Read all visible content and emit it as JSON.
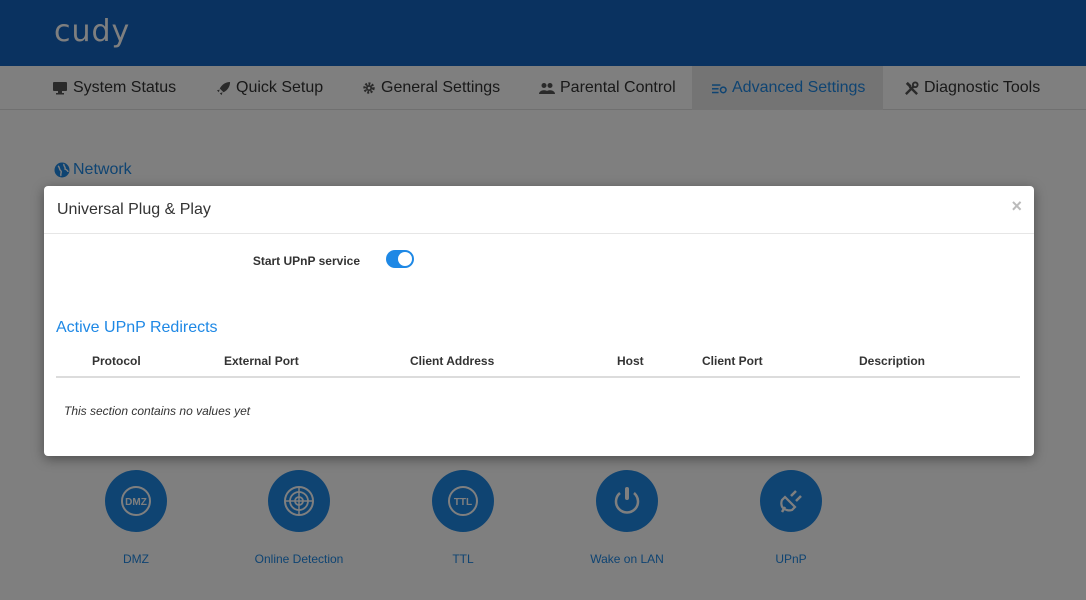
{
  "brand": {
    "logo": "cudy"
  },
  "nav": [
    {
      "label": "System Status",
      "icon": "monitor-icon"
    },
    {
      "label": "Quick Setup",
      "icon": "rocket-icon"
    },
    {
      "label": "General Settings",
      "icon": "gear-icon"
    },
    {
      "label": "Parental Control",
      "icon": "users-icon"
    },
    {
      "label": "Advanced Settings",
      "icon": "sliders-icon",
      "active": true
    },
    {
      "label": "Diagnostic Tools",
      "icon": "tools-icon"
    }
  ],
  "section": {
    "title": "Network",
    "icon": "globe-icon"
  },
  "tiles": [
    {
      "label": "DMZ",
      "icon": "dmz-icon",
      "text": "DMZ"
    },
    {
      "label": "Online Detection",
      "icon": "target-icon"
    },
    {
      "label": "TTL",
      "icon": "ttl-icon",
      "text": "TTL"
    },
    {
      "label": "Wake on LAN",
      "icon": "power-icon"
    },
    {
      "label": "UPnP",
      "icon": "plug-icon"
    }
  ],
  "modal": {
    "title": "Universal Plug & Play",
    "close": "×",
    "field_label": "Start UPnP service",
    "toggle_on": true,
    "subtitle": "Active UPnP Redirects",
    "columns": [
      "Protocol",
      "External Port",
      "Client Address",
      "Host",
      "Client Port",
      "Description"
    ],
    "empty_message": "This section contains no values yet"
  },
  "colors": {
    "brand": "#1565c0",
    "accent": "#1e88e5"
  }
}
